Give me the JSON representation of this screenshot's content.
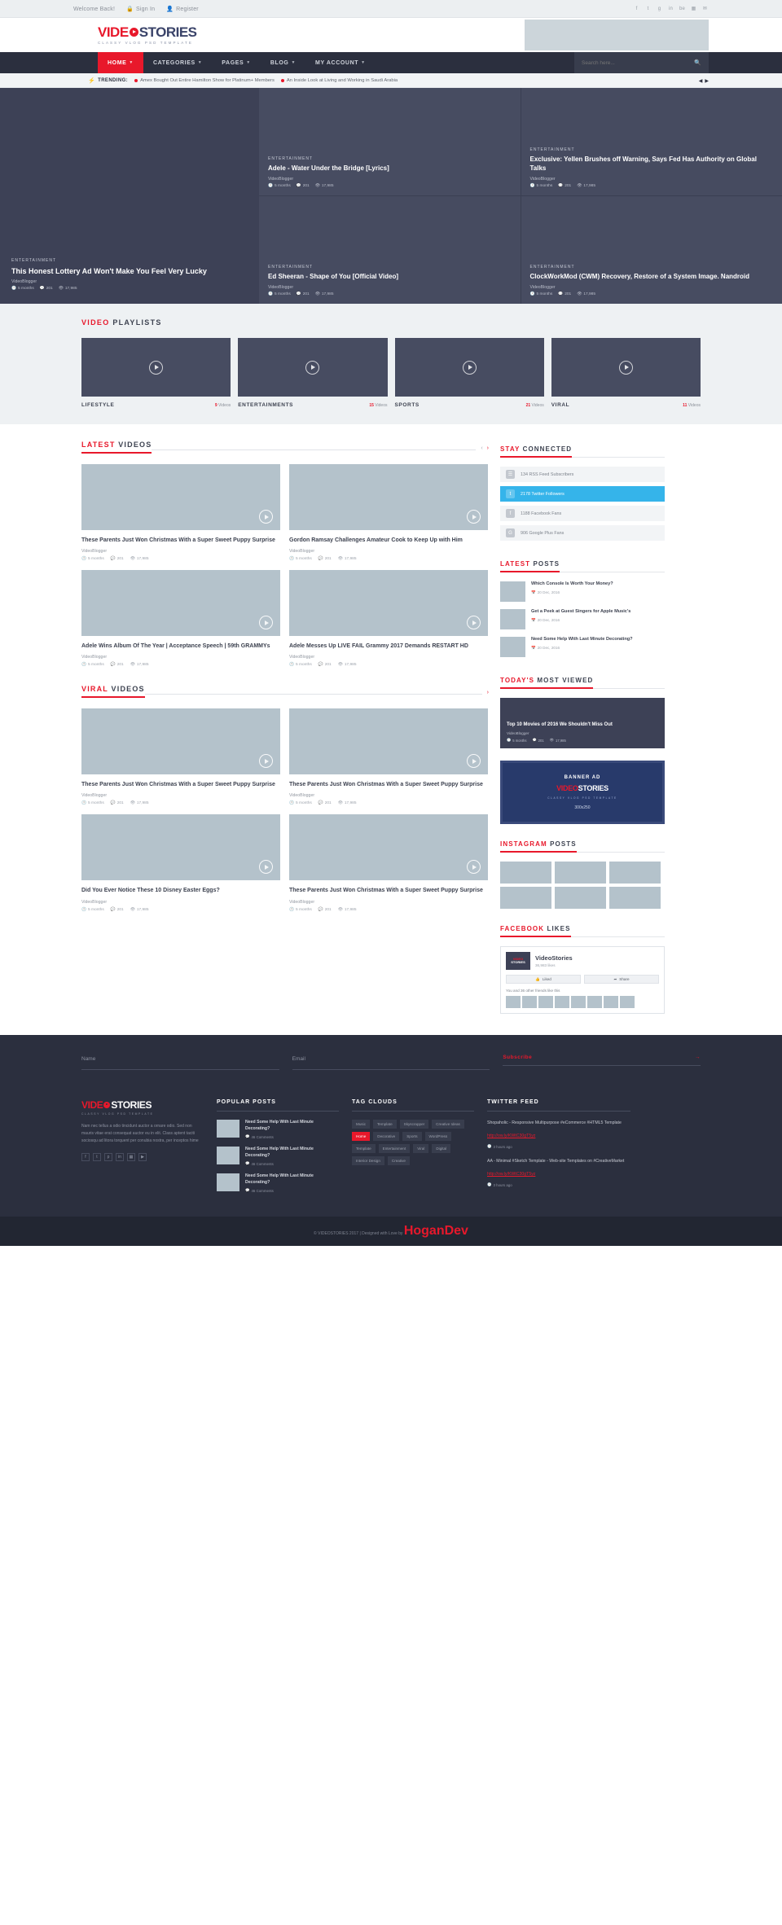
{
  "topbar": {
    "welcome": "Welcome Back!",
    "signin": "Sign In",
    "register": "Register",
    "socials": [
      "f",
      "t",
      "g",
      "in",
      "be",
      "▦",
      "✉"
    ]
  },
  "brand": {
    "name_part1": "VIDE",
    "name_part2": "STORIES",
    "tagline": "CLASSY VLOG PSD TEMPLATE"
  },
  "nav": {
    "items": [
      {
        "label": "HOME",
        "active": true
      },
      {
        "label": "CATEGORIES",
        "active": false
      },
      {
        "label": "PAGES",
        "active": false
      },
      {
        "label": "BLOG",
        "active": false
      },
      {
        "label": "MY ACCOUNT",
        "active": false
      }
    ],
    "search_placeholder": "Search here..."
  },
  "trending": {
    "label": "TRENDING:",
    "items": [
      "Amex Bought Out Entire Hamilton Show for Platinum+ Members",
      "An Inside Look at Living and Working in Saudi Arabia"
    ]
  },
  "hero": {
    "main": {
      "category": "ENTERTAINMENT",
      "title": "This Honest Lottery Ad Won't Make You Feel Very Lucky",
      "author": "VideoBlogger",
      "date": "5 months",
      "comments": "201",
      "views": "17,985"
    },
    "cards": [
      {
        "category": "ENTERTAINMENT",
        "title": "Adele - Water Under the Bridge [Lyrics]",
        "author": "VideoBlogger",
        "date": "5 months",
        "comments": "201",
        "views": "17,985"
      },
      {
        "category": "ENTERTAINMENT",
        "title": "Exclusive: Yellen Brushes off Warning, Says Fed Has Authority on Global Talks",
        "author": "VideoBlogger",
        "date": "5 months",
        "comments": "201",
        "views": "17,985"
      },
      {
        "category": "ENTERTAINMENT",
        "title": "Ed Sheeran - Shape of You [Official Video]",
        "author": "VideoBlogger",
        "date": "5 months",
        "comments": "201",
        "views": "17,985"
      },
      {
        "category": "ENTERTAINMENT",
        "title": "ClockWorkMod (CWM) Recovery, Restore of a System Image. Nandroid",
        "author": "VideoBlogger",
        "date": "5 months",
        "comments": "201",
        "views": "17,985"
      }
    ]
  },
  "playlists": {
    "heading_red": "VIDEO",
    "heading_dark": "PLAYLISTS",
    "items": [
      {
        "name": "LIFESTYLE",
        "count": "9",
        "unit": "Videos"
      },
      {
        "name": "ENTERTAINMENTS",
        "count": "15",
        "unit": "Videos"
      },
      {
        "name": "SPORTS",
        "count": "21",
        "unit": "Videos"
      },
      {
        "name": "VIRAL",
        "count": "11",
        "unit": "Videos"
      }
    ]
  },
  "latest_videos": {
    "heading_red": "LATEST",
    "heading_dark": "VIDEOS",
    "items": [
      {
        "title": "These Parents Just Won Christmas With a Super Sweet Puppy Surprise",
        "author": "VideoBlogger",
        "date": "5 months",
        "comments": "201",
        "views": "17,985"
      },
      {
        "title": "Gordon Ramsay Challenges Amateur Cook to Keep Up with Him",
        "author": "VideoBlogger",
        "date": "5 months",
        "comments": "201",
        "views": "17,985"
      },
      {
        "title": "Adele Wins Album Of The Year | Acceptance Speech | 59th GRAMMYs",
        "author": "VideoBlogger",
        "date": "5 months",
        "comments": "201",
        "views": "17,985"
      },
      {
        "title": "Adele Messes Up LIVE FAIL Grammy 2017 Demands RESTART HD",
        "author": "VideoBlogger",
        "date": "5 months",
        "comments": "201",
        "views": "17,985"
      }
    ]
  },
  "viral_videos": {
    "heading_red": "VIRAL",
    "heading_dark": "VIDEOS",
    "items": [
      {
        "title": "These Parents Just Won Christmas With a Super Sweet Puppy Surprise",
        "author": "VideoBlogger",
        "date": "5 months",
        "comments": "201",
        "views": "17,985"
      },
      {
        "title": "These Parents Just Won Christmas With a Super Sweet Puppy Surprise",
        "author": "VideoBlogger",
        "date": "5 months",
        "comments": "201",
        "views": "17,985"
      },
      {
        "title": "Did You Ever Notice These 10 Disney Easter Eggs?",
        "author": "VideoBlogger",
        "date": "5 months",
        "comments": "201",
        "views": "17,985"
      },
      {
        "title": "These Parents Just Won Christmas With a Super Sweet Puppy Surprise",
        "author": "VideoBlogger",
        "date": "5 months",
        "comments": "201",
        "views": "17,985"
      }
    ]
  },
  "sidebar": {
    "stay_connected": {
      "heading_red": "STAY",
      "heading_dark": "CONNECTED",
      "rows": [
        {
          "icon": "rss-icon",
          "glyph": "☰",
          "text": "134 RSS Feed Subscribers"
        },
        {
          "icon": "twitter-icon",
          "glyph": "t",
          "text": "2178 Twitter Followers",
          "highlight": true
        },
        {
          "icon": "facebook-icon",
          "glyph": "f",
          "text": "1188 Facebook Fans"
        },
        {
          "icon": "googleplus-icon",
          "glyph": "G",
          "text": "906 Google Plus Fans"
        }
      ]
    },
    "latest_posts": {
      "heading_red": "LATEST",
      "heading_dark": "POSTS",
      "items": [
        {
          "title": "Which Console Is Worth Your Money?",
          "date": "20 Dec, 2016"
        },
        {
          "title": "Get a Peek at Guest Singers for Apple Music's",
          "date": "20 Dec, 2016"
        },
        {
          "title": "Need Some Help With Last Minute Decorating?",
          "date": "20 Dec, 2016"
        }
      ]
    },
    "most_viewed": {
      "heading_red": "TODAY'S",
      "heading_dark": "MOST VIEWED",
      "card": {
        "title": "Top 10 Movies  of 2016 We Shouldn't Miss Out",
        "author": "VideoBlogger",
        "date": "5 months",
        "comments": "201",
        "views": "17,985"
      }
    },
    "banner_ad": {
      "label": "BANNER AD",
      "logo_red": "VIDEO",
      "logo_white": "STORIES",
      "sub": "CLASSY VLOG PSD TEMPLATE",
      "size": "300x250"
    },
    "instagram": {
      "heading_red": "INSTAGRAM",
      "heading_dark": "POSTS",
      "cell_count": 6
    },
    "facebook": {
      "heading_red": "FACEBOOK",
      "heading_dark": "LIKES",
      "page_name": "VideoStories",
      "likes": "36,983 likes",
      "like_btn": "Liked",
      "share_btn": "Share",
      "friends_text": "You and 36 other friends like this",
      "thumb_red": "VIDEO",
      "thumb_white": "STORIES"
    }
  },
  "subscribe": {
    "name_placeholder": "Name",
    "email_placeholder": "Email",
    "button": "Subscribe"
  },
  "footer": {
    "about_text": "Nam nec tellus a odio tincidunt auctor a ornare odio. Sed non mauris vitae erat consequat auctor eu in elit. Class aptent taciti sociosqu ad litora torquent per conubia nostra, per inceptos hime",
    "socials": [
      "f",
      "t",
      "p",
      "in",
      "▦",
      "▶"
    ],
    "popular_posts": {
      "heading": "POPULAR POSTS",
      "items": [
        {
          "title": "Need Some Help With Last Minute Decorating?",
          "comments": "46 Comments"
        },
        {
          "title": "Need Some Help With Last Minute Decorating?",
          "comments": "46 Comments"
        },
        {
          "title": "Need Some Help With Last Minute Decorating?",
          "comments": "46 Comments"
        }
      ]
    },
    "tag_clouds": {
      "heading": "TAG CLOUDS",
      "tags": [
        {
          "label": "Music",
          "hot": false
        },
        {
          "label": "Template",
          "hot": false
        },
        {
          "label": "Skyscrapper",
          "hot": false
        },
        {
          "label": "Creative Ideas",
          "hot": false
        },
        {
          "label": "Home",
          "hot": true
        },
        {
          "label": "Decorative",
          "hot": false
        },
        {
          "label": "Sports",
          "hot": false
        },
        {
          "label": "WordPress",
          "hot": false
        },
        {
          "label": "Template",
          "hot": false
        },
        {
          "label": "Entertainment",
          "hot": false
        },
        {
          "label": "Viral",
          "hot": false
        },
        {
          "label": "Digital",
          "hot": false
        },
        {
          "label": "Interior Design",
          "hot": false
        },
        {
          "label": "Creative",
          "hot": false
        }
      ]
    },
    "twitter_feed": {
      "heading": "TWITTER FEED",
      "tweets": [
        {
          "text": "Shopaholic - Responsive Multipurpose #eCommerce #HTML5 Template",
          "link": "http://ow.ly/KWtC30gT5yz",
          "time": "3 hours ago"
        },
        {
          "text": "AA - Minimal #Sketch Template - Web-site Templates on #CreativeMarket",
          "link": "http://ow.ly/KWtC30gT5yz",
          "time": "3 hours ago"
        }
      ]
    }
  },
  "copyright": {
    "text_before": "© VIDEOSTORIES 2017 | Designed with Love by ",
    "brand": "HoganDev"
  }
}
